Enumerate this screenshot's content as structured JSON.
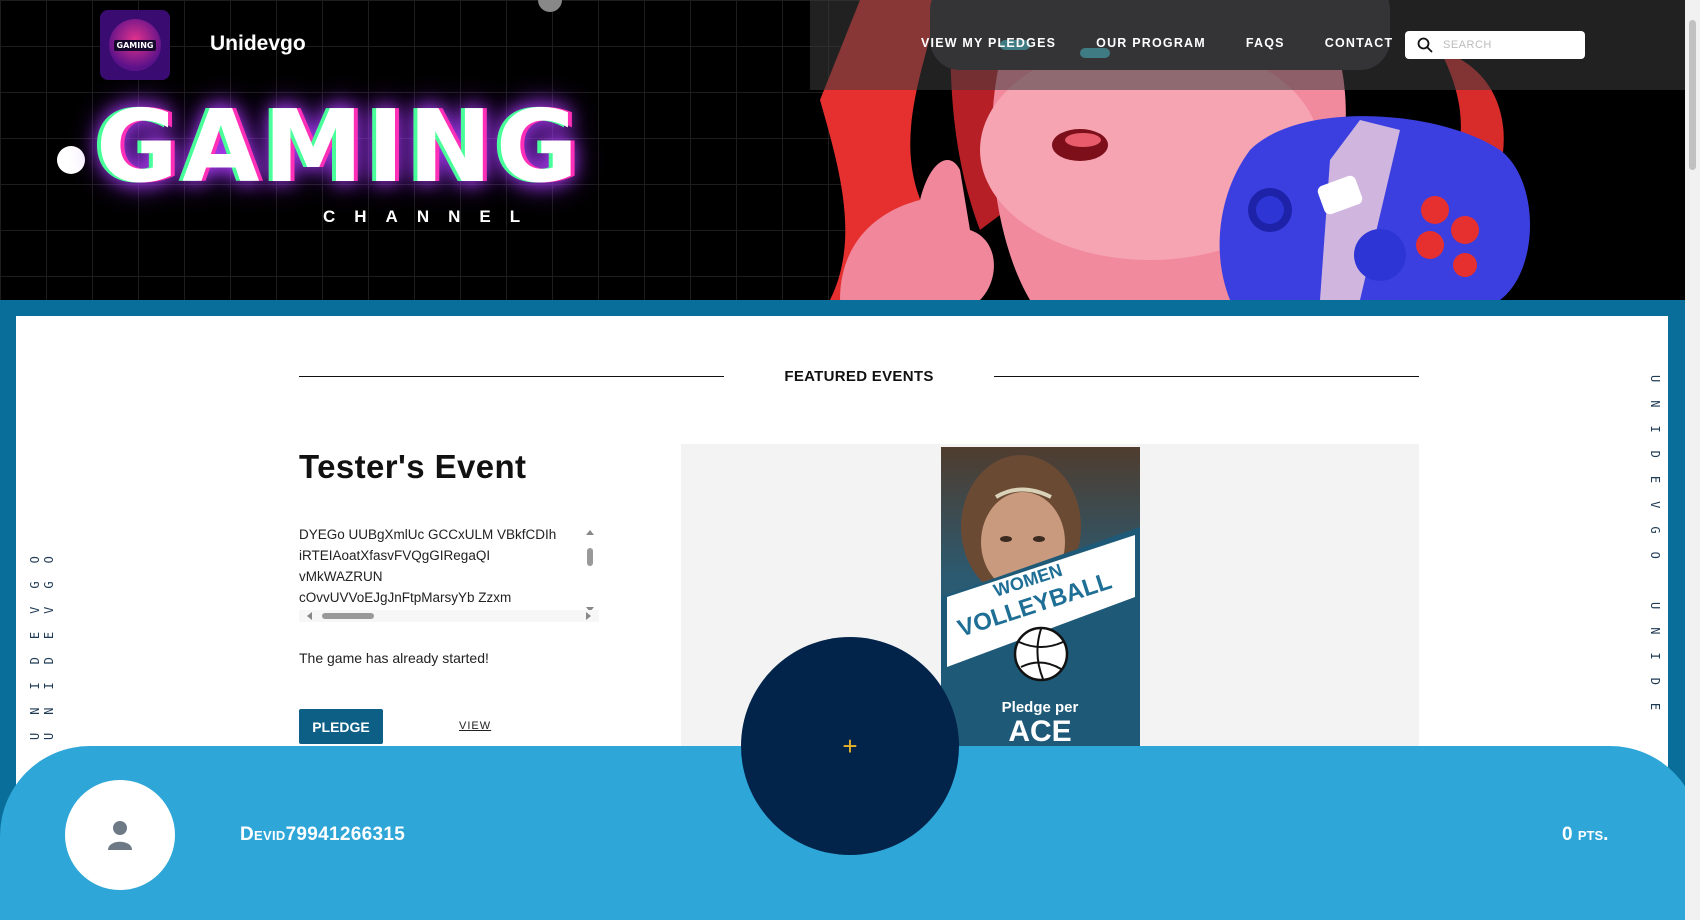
{
  "header": {
    "brand": "Unidevgo",
    "logo_text": "GAMING",
    "hero_title": "GAMING",
    "hero_subtitle": "CHANNEL",
    "nav": [
      "VIEW MY PLEDGES",
      "OUR PROGRAM",
      "FAQS",
      "CONTACT"
    ],
    "search_placeholder": "SEARCH"
  },
  "side_rail": {
    "left_text": "UNIDEVGO UNIDEVGO",
    "right_text": "UNIDEVGO UNIDE"
  },
  "featured": {
    "heading": "FEATURED EVENTS",
    "event_title": "Tester's Event",
    "description_lines": [
      "DYEGo UUBgXmlUc GCCxULM VBkfCDIh",
      "iRTEIAoatXfasvFVQgGIRegaQI",
      "vMkWAZRUN",
      "cOvvUVVoEJgJnFtpMarsyYb Zzxm"
    ],
    "status": "The game has already started!",
    "pledge_label": "PLEDGE",
    "view_label": "VIEW",
    "poster": {
      "line1": "WOMEN",
      "line2": "VOLLEYBALL",
      "line3": "Pledge per",
      "line4": "ACE"
    }
  },
  "user_bar": {
    "username": "Devid79941266315",
    "points": "0 pts.",
    "fab_icon": "+"
  },
  "colors": {
    "accent": "#0d5f86",
    "bottom_bar": "#2ea6d8",
    "fab": "#02244a",
    "fab_plus": "#e8b326"
  }
}
